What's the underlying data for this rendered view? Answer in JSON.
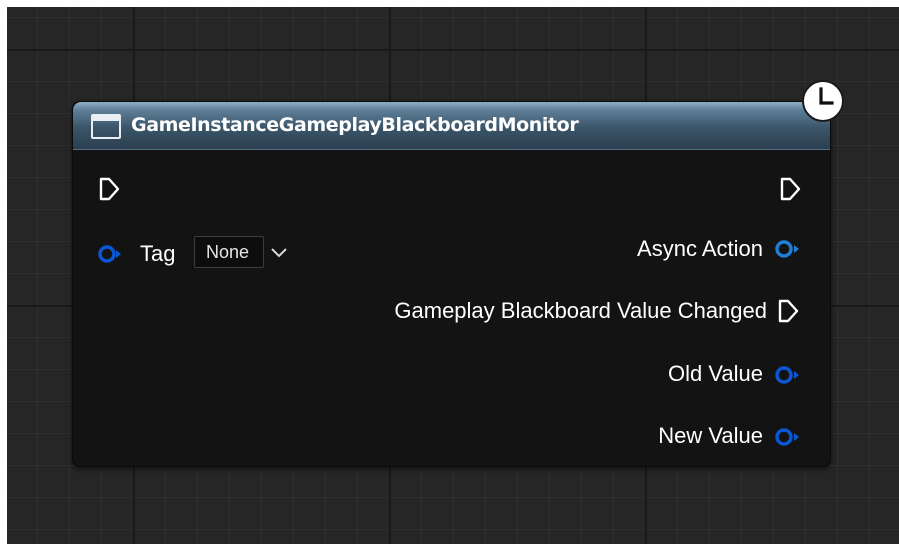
{
  "node": {
    "title": "GameInstanceGameplayBlackboardMonitor",
    "title_icon": "function-node-icon",
    "latent_icon": "clock-icon",
    "inputs": {
      "exec_icon": "exec-pin-icon",
      "tag": {
        "label": "Tag",
        "value": "None",
        "pin_icon": "data-pin-icon",
        "dropdown_icon": "chevron-down-icon"
      }
    },
    "outputs": {
      "exec_icon": "exec-pin-icon",
      "async_action": "Async Action",
      "value_changed": "Gameplay Blackboard Value Changed",
      "old_value": "Old Value",
      "new_value": "New Value"
    }
  },
  "colors": {
    "graph_background": "#262626",
    "node_body": "#131313",
    "header": "#3a5569",
    "object_pin": "#1f7fd6",
    "struct_pin": "#0a57d6",
    "exec_pin": "#ffffff"
  }
}
